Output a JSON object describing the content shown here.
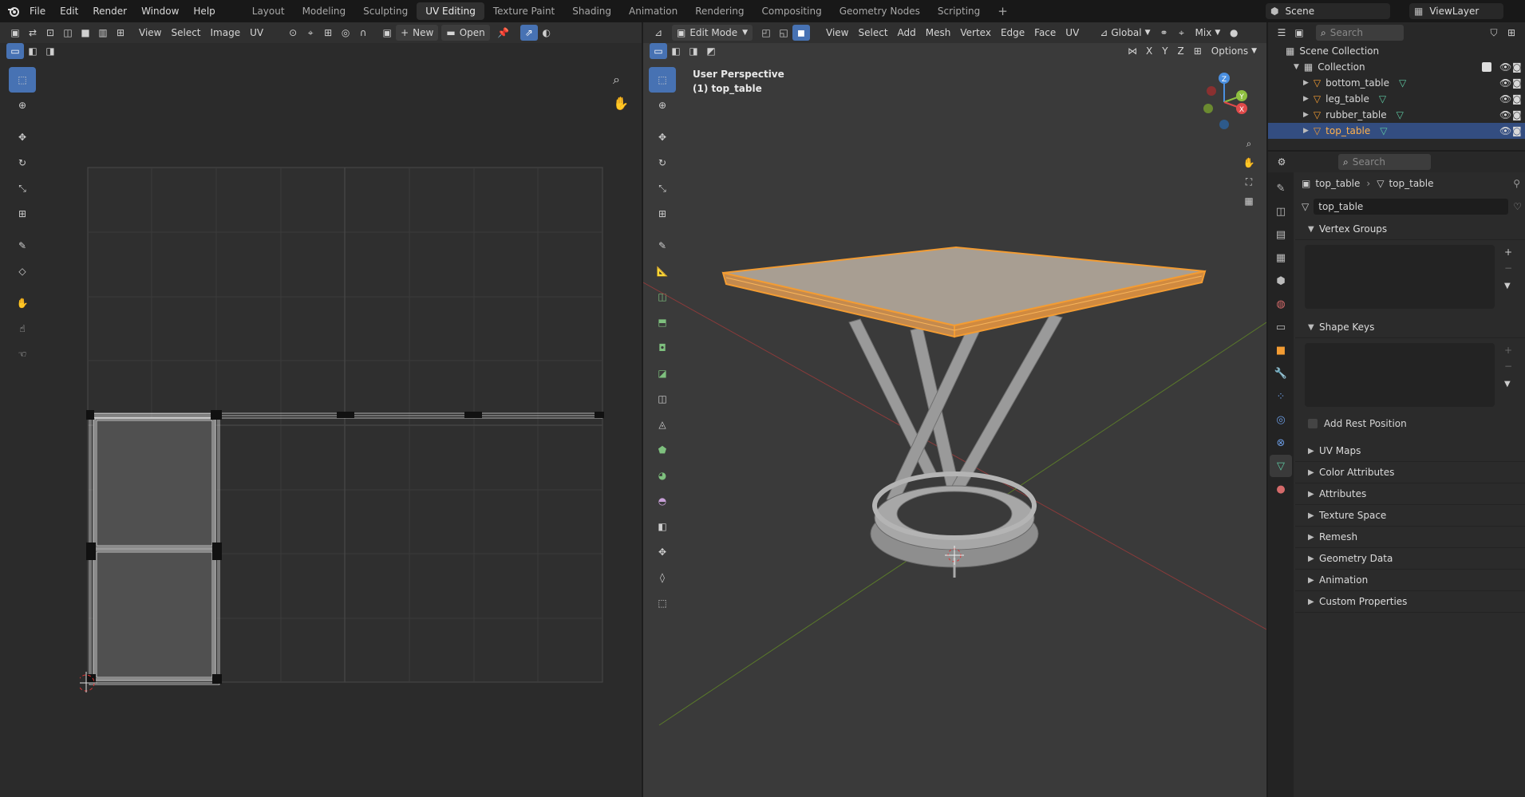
{
  "topbar": {
    "menus": [
      "File",
      "Edit",
      "Render",
      "Window",
      "Help"
    ],
    "workspaces": [
      "Layout",
      "Modeling",
      "Sculpting",
      "UV Editing",
      "Texture Paint",
      "Shading",
      "Animation",
      "Rendering",
      "Compositing",
      "Geometry Nodes",
      "Scripting"
    ],
    "active_workspace": "UV Editing",
    "add_tab": "+",
    "scene": "Scene",
    "view_layer": "ViewLayer"
  },
  "uv_editor": {
    "header_menus": [
      "View",
      "Select",
      "Image",
      "UV"
    ],
    "new_label": "New",
    "open_label": "Open"
  },
  "viewport": {
    "mode": "Edit Mode",
    "header_menus": [
      "View",
      "Select",
      "Add",
      "Mesh",
      "Vertex",
      "Edge",
      "Face",
      "UV"
    ],
    "orientation": "Global",
    "proportional": "Mix",
    "options_label": "Options",
    "axes": [
      "X",
      "Y",
      "Z"
    ],
    "perspective_label": "User Perspective",
    "object_label": "(1) top_table",
    "gizmo": {
      "x": "X",
      "y": "Y",
      "z": "Z"
    }
  },
  "outliner": {
    "search_placeholder": "Search",
    "scene_collection": "Scene Collection",
    "collection": "Collection",
    "objects": [
      "bottom_table",
      "leg_table",
      "rubber_table",
      "top_table"
    ],
    "active_object": "top_table"
  },
  "properties": {
    "search_placeholder": "Search",
    "breadcrumb_object": "top_table",
    "breadcrumb_data": "top_table",
    "data_name": "top_table",
    "panels": {
      "vertex_groups": "Vertex Groups",
      "shape_keys": "Shape Keys",
      "add_rest_position": "Add Rest Position",
      "collapsed": [
        "UV Maps",
        "Color Attributes",
        "Attributes",
        "Texture Space",
        "Remesh",
        "Geometry Data",
        "Animation",
        "Custom Properties"
      ]
    }
  },
  "colors": {
    "accent": "#4772b3",
    "selection_orange": "#f39c33",
    "active_row": "#334d80",
    "mesh_grey": "#a9a9a9"
  }
}
